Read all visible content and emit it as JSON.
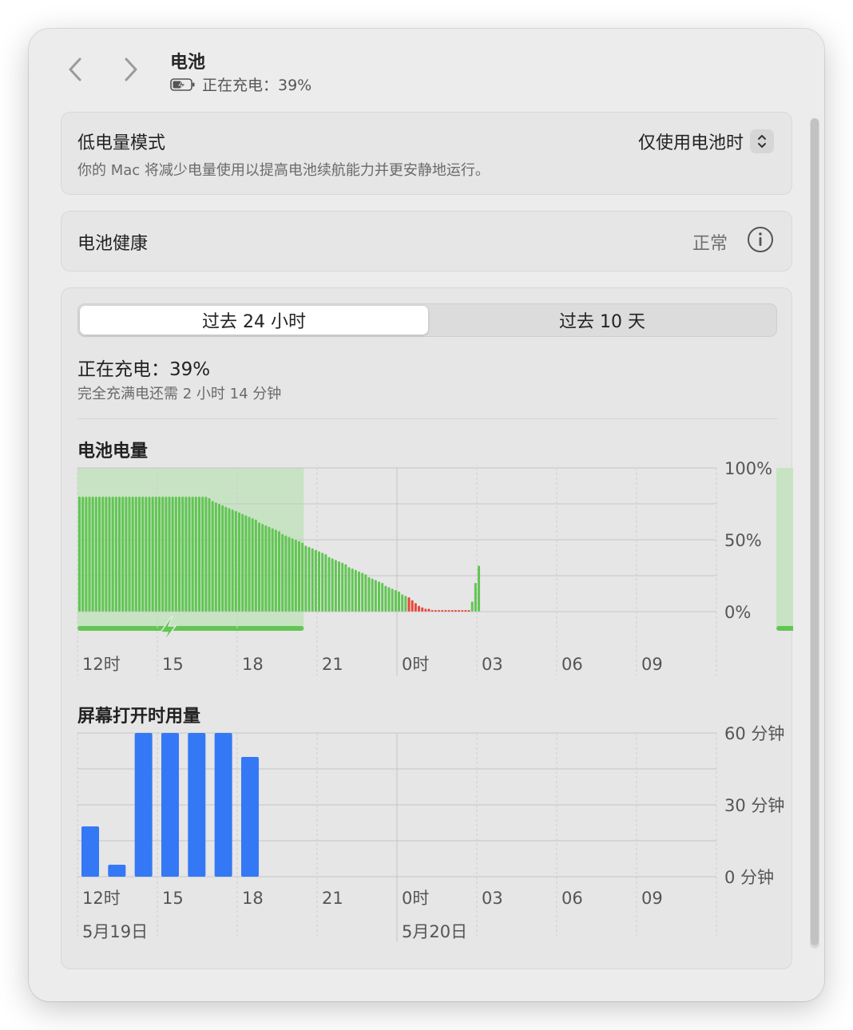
{
  "header": {
    "title": "电池",
    "subtitle": "正在充电：39%"
  },
  "low_power": {
    "title": "低电量模式",
    "description": "你的 Mac 将减少电量使用以提高电池续航能力并更安静地运行。",
    "selected_option": "仅使用电池时"
  },
  "battery_health": {
    "title": "电池健康",
    "status": "正常"
  },
  "tabs": [
    {
      "label": "过去 24 小时",
      "active": true
    },
    {
      "label": "过去 10 天",
      "active": false
    }
  ],
  "status": {
    "main": "正在充电：39%",
    "sub": "完全充满电还需 2 小时 14 分钟"
  },
  "colors": {
    "battery_bar": "#62c554",
    "battery_low": "#e8473a",
    "charging_band": "#c7e3c3",
    "screen_bar": "#3478f6"
  },
  "icons": [
    "chevron-left-icon",
    "chevron-right-icon",
    "battery-charging-icon",
    "stepper-icon",
    "info-icon",
    "bolt-icon"
  ],
  "chart_data": [
    {
      "type": "bar",
      "title": "电池电量",
      "x_tick_labels": [
        "12时",
        "15",
        "18",
        "21",
        "0时",
        "03",
        "06",
        "09"
      ],
      "y_tick_labels": [
        "100%",
        "50%",
        "0%"
      ],
      "ylim": [
        0,
        100
      ],
      "series": [
        {
          "unit": "%",
          "values": [
            80,
            80,
            80,
            80,
            80,
            80,
            80,
            80,
            80,
            80,
            80,
            80,
            80,
            80,
            80,
            80,
            80,
            80,
            80,
            80,
            80,
            80,
            80,
            80,
            80,
            80,
            80,
            80,
            80,
            80,
            80,
            80,
            80,
            80,
            80,
            80,
            80,
            80,
            80,
            79,
            77,
            76,
            75,
            74,
            73,
            72,
            71,
            70,
            69,
            68,
            67,
            66,
            65,
            64,
            62,
            61,
            60,
            59,
            58,
            57,
            56,
            54,
            53,
            52,
            51,
            50,
            49,
            48,
            46,
            45,
            44,
            43,
            42,
            41,
            40,
            38,
            37,
            36,
            35,
            34,
            33,
            31,
            30,
            29,
            28,
            27,
            26,
            24,
            23,
            22,
            21,
            20,
            18,
            17,
            16,
            15,
            14,
            12,
            11,
            10,
            8,
            6,
            4,
            3,
            2,
            2,
            1,
            1,
            1,
            1,
            1,
            1,
            1,
            1,
            1,
            1,
            1,
            1,
            7,
            20,
            32
          ]
        }
      ],
      "charging_periods": [
        [
          0,
          68
        ],
        [
          210,
          216
        ]
      ],
      "grid": true
    },
    {
      "type": "bar",
      "title": "屏幕打开时用量",
      "x_tick_labels": [
        "12时",
        "15",
        "18",
        "21",
        "0时",
        "03",
        "06",
        "09"
      ],
      "date_labels": [
        "5月19日",
        "5月20日"
      ],
      "y_tick_labels": [
        "60 分钟",
        "30 分钟",
        "0 分钟"
      ],
      "ylim": [
        0,
        60
      ],
      "series": [
        {
          "unit": "分钟",
          "values": [
            21,
            5,
            60,
            60,
            60,
            60,
            50,
            0,
            0,
            0,
            0,
            0,
            0,
            0,
            0,
            0,
            0,
            0,
            0,
            0,
            0,
            0,
            0,
            0
          ]
        }
      ],
      "grid": true
    }
  ]
}
